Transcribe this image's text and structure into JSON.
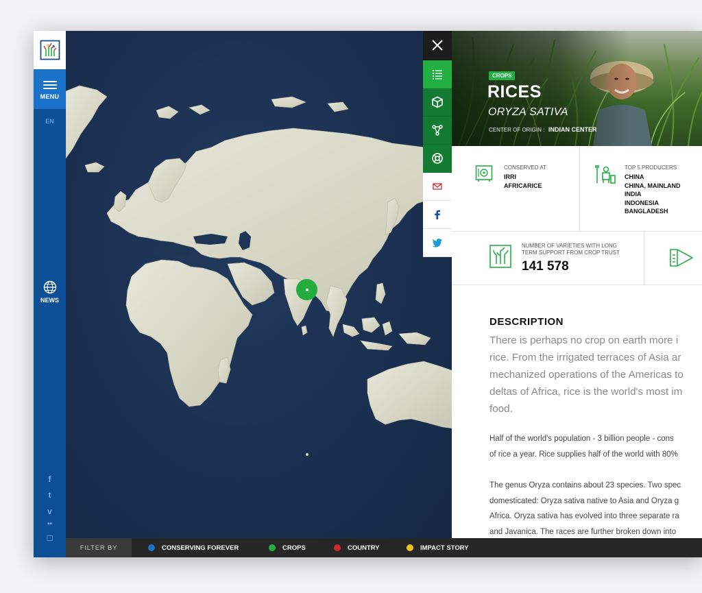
{
  "sidebar": {
    "menu_label": "MENU",
    "language": "EN",
    "news_label": "NEWS",
    "social": [
      "f",
      "t",
      "v",
      "••",
      "☐"
    ]
  },
  "toolbar": {
    "icons": [
      "close-icon",
      "list-icon",
      "cube-icon",
      "network-icon",
      "lifebuoy-icon",
      "mail-icon",
      "facebook-icon",
      "twitter-icon"
    ]
  },
  "crop": {
    "tag": "CROPS",
    "title": "RICES",
    "latin": "ORYZA SATIVA",
    "origin_label": "CENTER OF ORIGIN :",
    "origin_value": "INDIAN CENTER"
  },
  "stats": {
    "conserved_label": "CONSERVED AT",
    "conserved_values": "IRRI\nAFRICARICE",
    "producers_label": "TOP 5 PRODUCERS",
    "producers_values": "CHINA\nCHINA, MAINLAND\nINDIA\nINDONESIA\nBANGLADESH",
    "varieties_label": "NUMBER OF VARIETIES WITH LONG\nTERM SUPPORT FROM CROP TRUST",
    "varieties_value": "141 578"
  },
  "description": {
    "heading": "DESCRIPTION",
    "lead": "There is perhaps no crop on earth more i\nrice. From the irrigated terraces of Asia ar\nmechanized operations of the Americas to\ndeltas of Africa, rice is the world's most im\nfood.",
    "p1": "Half of the world's population - 3 billion people - cons\nof rice a year. Rice supplies half of the world with 80%",
    "p2": "The genus Oryza contains about 23 species. Two spec\ndomesticated: Oryza sativa native to Asia and Oryza g\nAfrica. Oryza sativa has evolved into three separate ra\nand Javanica. The races are further broken down into"
  },
  "filter": {
    "label": "FILTER BY",
    "items": [
      {
        "label": "CONSERVING FOREVER",
        "color": "#1a72c9"
      },
      {
        "label": "CROPS",
        "color": "#22b043"
      },
      {
        "label": "COUNTRY",
        "color": "#d3262a"
      },
      {
        "label": "IMPACT STORY",
        "color": "#f1c21b"
      }
    ]
  },
  "colors": {
    "sidebar": "#0c4f96",
    "accent_blue": "#1a72c9",
    "accent_green": "#22b043",
    "ocean": "#1b2d4b"
  }
}
